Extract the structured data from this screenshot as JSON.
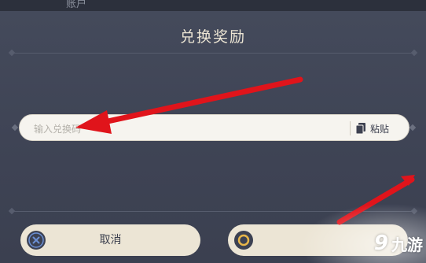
{
  "header": {
    "tab_label": "账户"
  },
  "dialog": {
    "title": "兑换奖励",
    "code_input": {
      "placeholder": "输入兑换码",
      "value": ""
    },
    "paste_label": "粘贴",
    "cancel_label": "取消",
    "confirm_label": ""
  },
  "icons": {
    "paste": "clipboard-icon",
    "cancel": "close-icon",
    "confirm": "circle-icon",
    "annotation": "red-arrow"
  },
  "watermark": {
    "logo": "9",
    "text": "九游"
  },
  "colors": {
    "background": "#3c4152",
    "title_text": "#ece5d4",
    "button_bg": "#ece5d5",
    "input_bg": "#f6f4ef",
    "arrow": "#e0141b"
  }
}
